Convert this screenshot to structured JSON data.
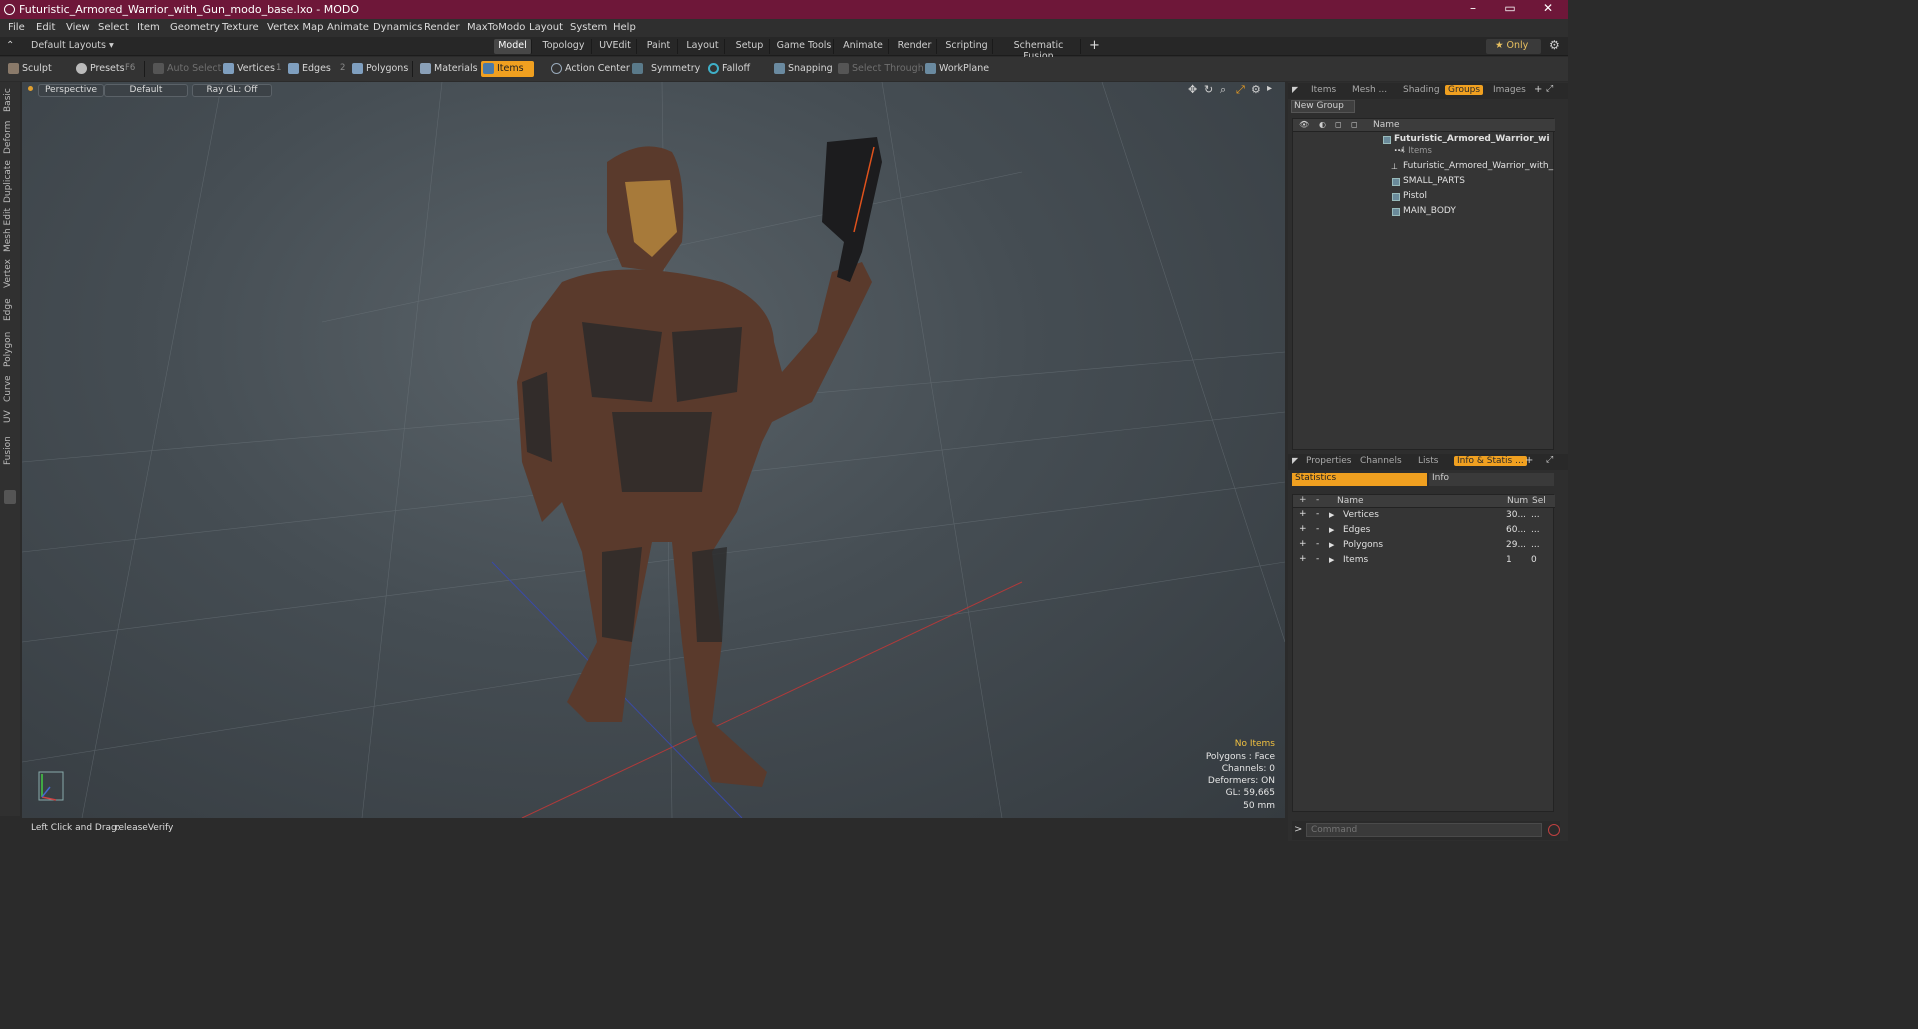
{
  "window": {
    "title": "Futuristic_Armored_Warrior_with_Gun_modo_base.lxo - MODO",
    "minimize": "–",
    "maximize": "▭",
    "close": "✕"
  },
  "menu": [
    "File",
    "Edit",
    "View",
    "Select",
    "Item",
    "Geometry",
    "Texture",
    "Vertex Map",
    "Animate",
    "Dynamics",
    "Render",
    "MaxToModo",
    "Layout",
    "System",
    "Help"
  ],
  "layout_selector": "Default Layouts ▾",
  "tabs": [
    "Model",
    "Topology",
    "UVEdit",
    "Paint",
    "Layout",
    "Setup",
    "Game Tools",
    "Animate",
    "Render",
    "Scripting",
    "Schematic Fusion"
  ],
  "tab_add": "+",
  "only_label": "★  Only",
  "toolbar": {
    "sculpt": "Sculpt",
    "presets": "Presets",
    "presets_key": "F6",
    "auto_select": "Auto Select",
    "vertices": "Vertices",
    "vertices_key": "1",
    "edges": "Edges",
    "edges_key": "2",
    "polygons": "Polygons",
    "materials": "Materials",
    "items": "Items",
    "action_center": "Action Center",
    "symmetry": "Symmetry",
    "falloff": "Falloff",
    "snapping": "Snapping",
    "select_through": "Select Through",
    "workplane": "WorkPlane"
  },
  "left_tabs": [
    "Basic",
    "Deform",
    "Duplicate",
    "Mesh Edit",
    "Vertex",
    "Edge",
    "Polygon",
    "Curve",
    "UV",
    "Fusion"
  ],
  "viewport": {
    "view": "Perspective",
    "shading": "Default",
    "raygl": "Ray GL: Off",
    "info": {
      "no_items": "No Items",
      "polygons": "Polygons : Face",
      "channels": "Channels: 0",
      "deformers": "Deformers: ON",
      "gl": "GL: 59,665",
      "focal": "50 mm"
    }
  },
  "status": {
    "label": "Left Click and Drag:",
    "value": "releaseVerify"
  },
  "top_panel": {
    "tabs": [
      "Items",
      "Mesh ...",
      "Shading",
      "Groups",
      "Images"
    ],
    "active_tab": "Groups",
    "new_group": "New Group",
    "column_name": "Name",
    "root": "Futuristic_Armored_Warrior_wi ...",
    "root_count": "4 Items",
    "children": [
      "Futuristic_Armored_Warrior_with_ ...",
      "SMALL_PARTS",
      "Pistol",
      "MAIN_BODY"
    ]
  },
  "bottom_panel": {
    "tabs": [
      "Properties",
      "Channels",
      "Lists",
      "Info & Statis ..."
    ],
    "active_tab": "Info & Statis ...",
    "statistics": "Statistics",
    "info": "Info",
    "cols": {
      "name": "Name",
      "num": "Num",
      "sel": "Sel"
    },
    "rows": [
      {
        "name": "Vertices",
        "num": "30...",
        "sel": "..."
      },
      {
        "name": "Edges",
        "num": "60...",
        "sel": "..."
      },
      {
        "name": "Polygons",
        "num": "29...",
        "sel": "..."
      },
      {
        "name": "Items",
        "num": "1",
        "sel": "0"
      }
    ]
  },
  "command": {
    "prompt": ">",
    "placeholder": "Command"
  },
  "colors": {
    "title_bar": "#6e1739",
    "accent": "#f0a020",
    "armor": "#5a3a2c"
  }
}
